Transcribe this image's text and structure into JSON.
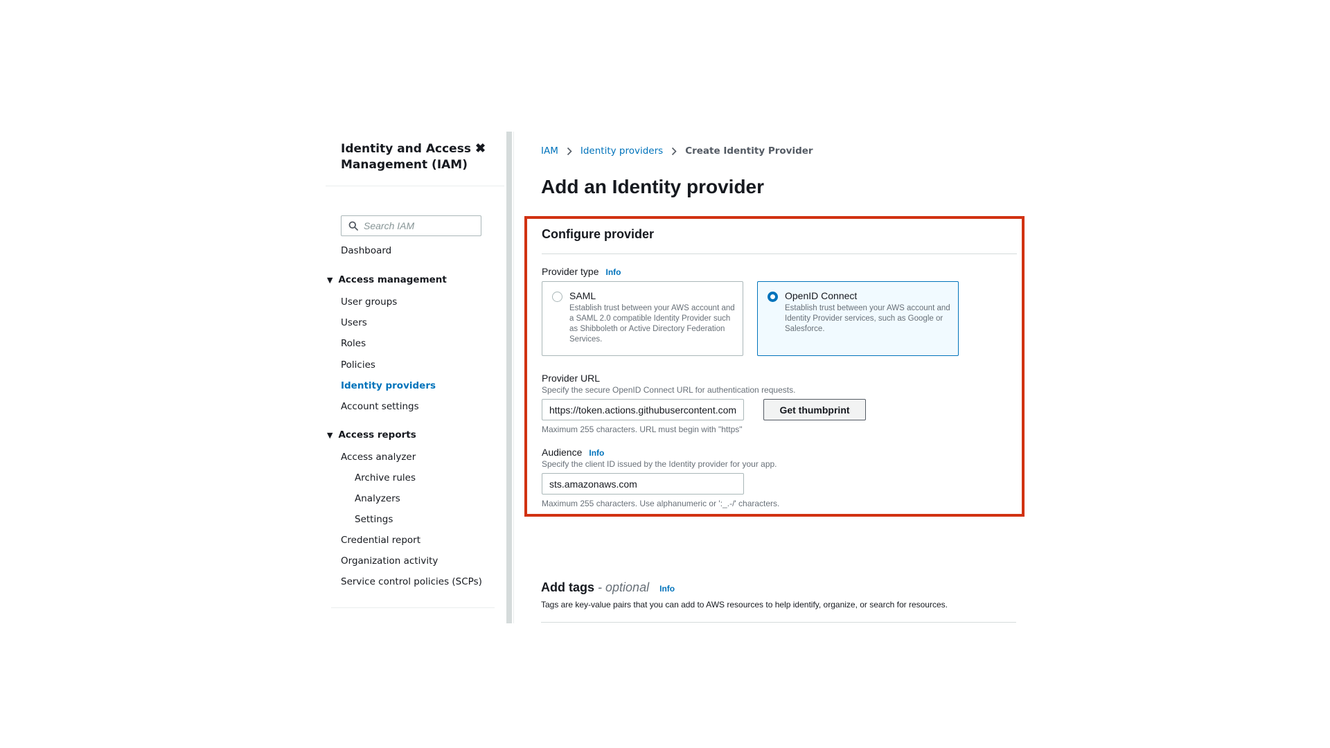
{
  "sidebar": {
    "title": "Identity and Access Management (IAM)",
    "search_placeholder": "Search IAM",
    "dashboard": "Dashboard",
    "access_management": {
      "label": "Access management",
      "items": [
        "User groups",
        "Users",
        "Roles",
        "Policies",
        "Identity providers",
        "Account settings"
      ]
    },
    "access_reports": {
      "label": "Access reports",
      "items": [
        "Access analyzer",
        "Archive rules",
        "Analyzers",
        "Settings",
        "Credential report",
        "Organization activity",
        "Service control policies (SCPs)"
      ]
    },
    "active_item": "Identity providers"
  },
  "breadcrumb": {
    "items": [
      "IAM",
      "Identity providers"
    ],
    "current": "Create Identity Provider"
  },
  "page": {
    "title": "Add an Identity provider"
  },
  "configure": {
    "title": "Configure provider",
    "provider_type_label": "Provider type",
    "info": "Info",
    "options": [
      {
        "name": "SAML",
        "description": "Establish trust between your AWS account and a SAML 2.0 compatible Identity Provider such as Shibboleth or Active Directory Federation Services.",
        "selected": false
      },
      {
        "name": "OpenID Connect",
        "description": "Establish trust between your AWS account and Identity Provider services, such as Google or Salesforce.",
        "selected": true
      }
    ],
    "provider_url": {
      "label": "Provider URL",
      "description": "Specify the secure OpenID Connect URL for authentication requests.",
      "value": "https://token.actions.githubusercontent.com",
      "hint": "Maximum 255 characters. URL must begin with \"https\""
    },
    "thumbprint_button": "Get thumbprint",
    "audience": {
      "label": "Audience",
      "description": "Specify the client ID issued by the Identity provider for your app.",
      "value": "sts.amazonaws.com",
      "hint": "Maximum 255 characters. Use alphanumeric or ':_.-/' characters."
    }
  },
  "tags": {
    "title": "Add tags",
    "optional": "- optional",
    "info": "Info",
    "description": "Tags are key-value pairs that you can add to AWS resources to help identify, organize, or search for resources."
  },
  "colors": {
    "accent": "#0073bb",
    "highlight_border": "#d13212",
    "selected_tile_bg": "#f1faff"
  }
}
